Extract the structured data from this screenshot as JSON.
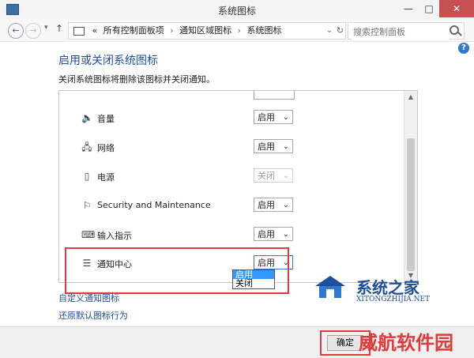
{
  "window": {
    "title": "系统图标"
  },
  "nav": {
    "breadcrumb_prefix": "«",
    "breadcrumbs": [
      "所有控制面板项",
      "通知区域图标",
      "系统图标"
    ],
    "search_placeholder": "搜索控制面板"
  },
  "content": {
    "heading": "启用或关闭系统图标",
    "description": "关闭系统图标将删除该图标并关闭通知。",
    "rows": [
      {
        "label": "音量",
        "value": "启用",
        "icon": "speaker-icon",
        "disabled": false
      },
      {
        "label": "网络",
        "value": "启用",
        "icon": "network-icon",
        "disabled": false
      },
      {
        "label": "电源",
        "value": "关闭",
        "icon": "power-icon",
        "disabled": true
      },
      {
        "label": "Security and Maintenance",
        "value": "启用",
        "icon": "flag-icon",
        "disabled": false
      },
      {
        "label": "输入指示",
        "value": "启用",
        "icon": "keyboard-icon",
        "disabled": false
      },
      {
        "label": "通知中心",
        "value": "启用",
        "icon": "notification-icon",
        "disabled": false
      }
    ],
    "dropdown_options": [
      "启用",
      "关闭"
    ],
    "links": [
      "自定义通知图标",
      "还原默认图标行为"
    ]
  },
  "footer": {
    "ok_label": "确定"
  },
  "watermarks": {
    "brand_cn": "系统之家",
    "brand_url": "XITONGZHIJIA.NET",
    "site2": "威航软件园"
  },
  "colors": {
    "accent": "#1f4fa0",
    "highlight_red": "#e03a3a",
    "selection_blue": "#3399ff"
  }
}
